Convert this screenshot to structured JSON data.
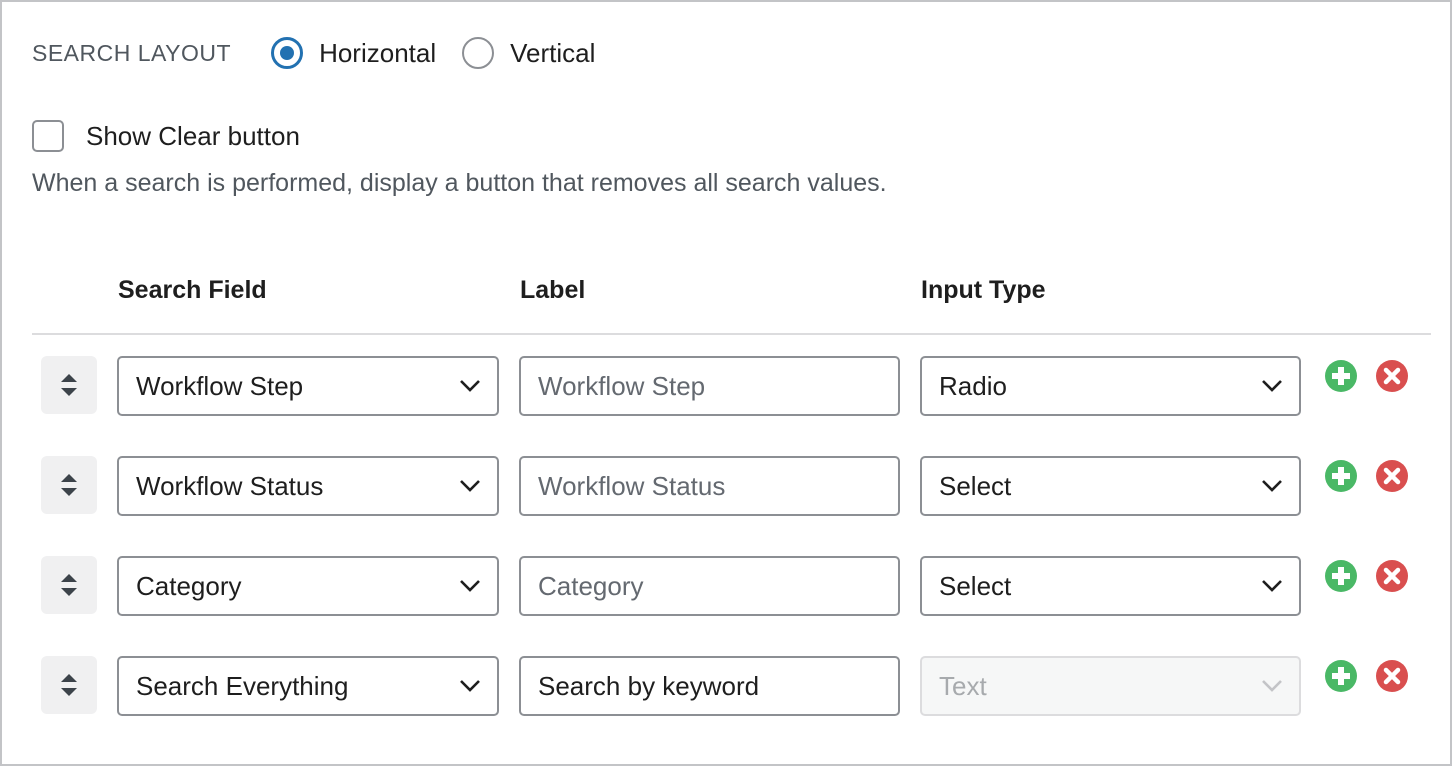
{
  "layout": {
    "label": "SEARCH LAYOUT",
    "options": [
      {
        "label": "Horizontal",
        "checked": true
      },
      {
        "label": "Vertical",
        "checked": false
      }
    ]
  },
  "clear_button": {
    "label": "Show Clear button",
    "checked": false,
    "description": "When a search is performed, display a button that removes all search values."
  },
  "table": {
    "headers": {
      "field": "Search Field",
      "label": "Label",
      "type": "Input Type"
    },
    "rows": [
      {
        "field": "Workflow Step",
        "label": "",
        "label_placeholder": "Workflow Step",
        "type": "Radio",
        "type_disabled": false
      },
      {
        "field": "Workflow Status",
        "label": "",
        "label_placeholder": "Workflow Status",
        "type": "Select",
        "type_disabled": false
      },
      {
        "field": "Category",
        "label": "",
        "label_placeholder": "Category",
        "type": "Select",
        "type_disabled": false
      },
      {
        "field": "Search Everything",
        "label": "Search by keyword",
        "label_placeholder": "",
        "type": "Text",
        "type_disabled": true
      }
    ]
  },
  "icons": {
    "handle": "sort-handle-icon",
    "add": "add-circle-icon",
    "remove": "remove-circle-icon",
    "chevron": "chevron-down-icon"
  },
  "colors": {
    "accent": "#2271b1",
    "add": "#4ab866",
    "remove": "#d94f4f"
  }
}
